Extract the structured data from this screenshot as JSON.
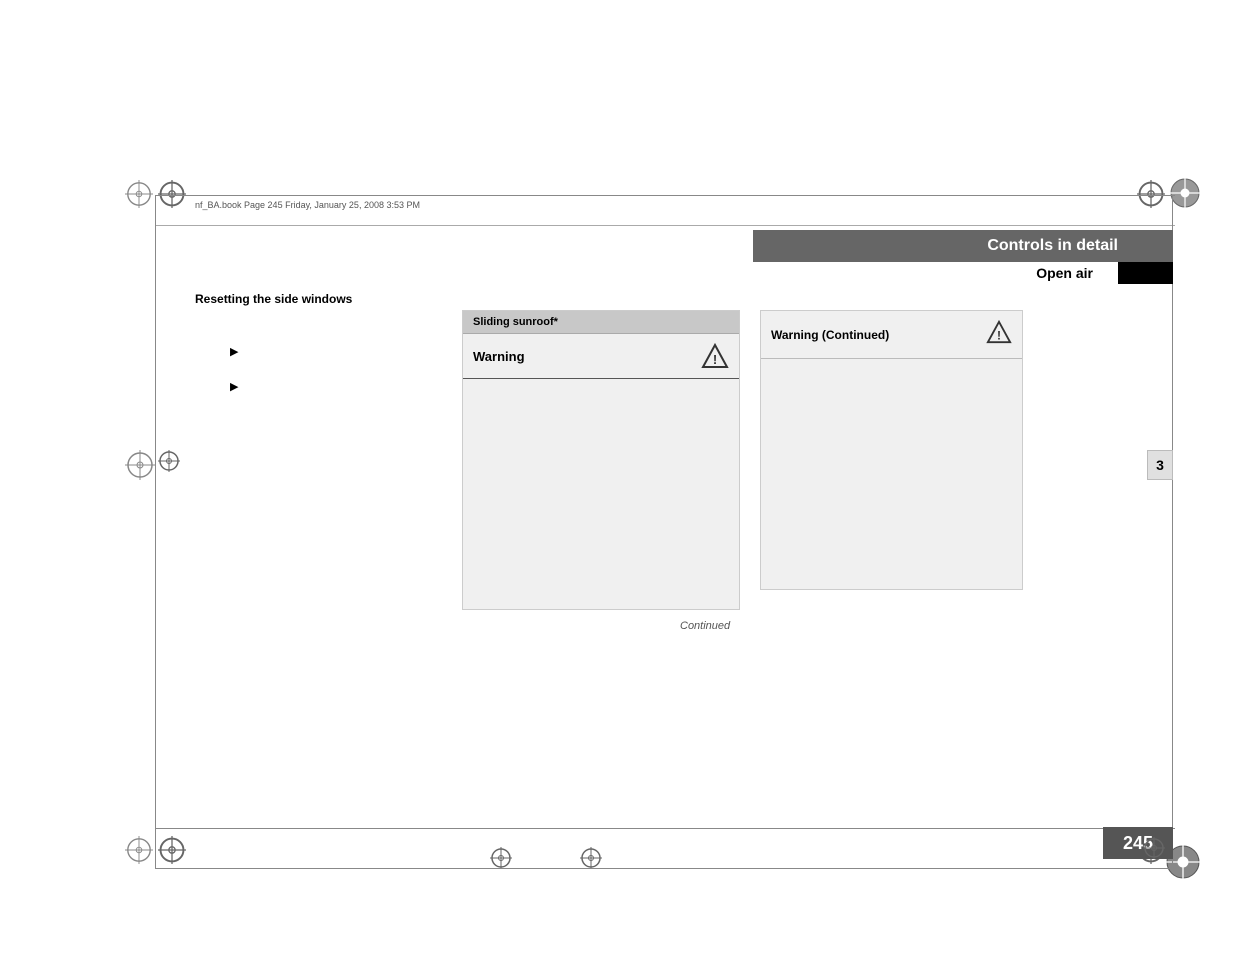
{
  "page": {
    "file_info": "nf_BA.book  Page 245  Friday, January 25, 2008  3:53 PM",
    "section_title": "Controls in detail",
    "open_air_label": "Open air",
    "page_number": "245",
    "chapter_number": "3",
    "continued_label": "Continued"
  },
  "left_section": {
    "heading": "Resetting the side windows",
    "bullet_1": "",
    "bullet_2": ""
  },
  "sliding_sunroof_box": {
    "header": "Sliding sunroof*",
    "warning_label": "Warning"
  },
  "warning_continued_box": {
    "header": "Warning (Continued)"
  },
  "icons": {
    "warning_triangle": "⚠",
    "bullet_arrow": "▶"
  }
}
